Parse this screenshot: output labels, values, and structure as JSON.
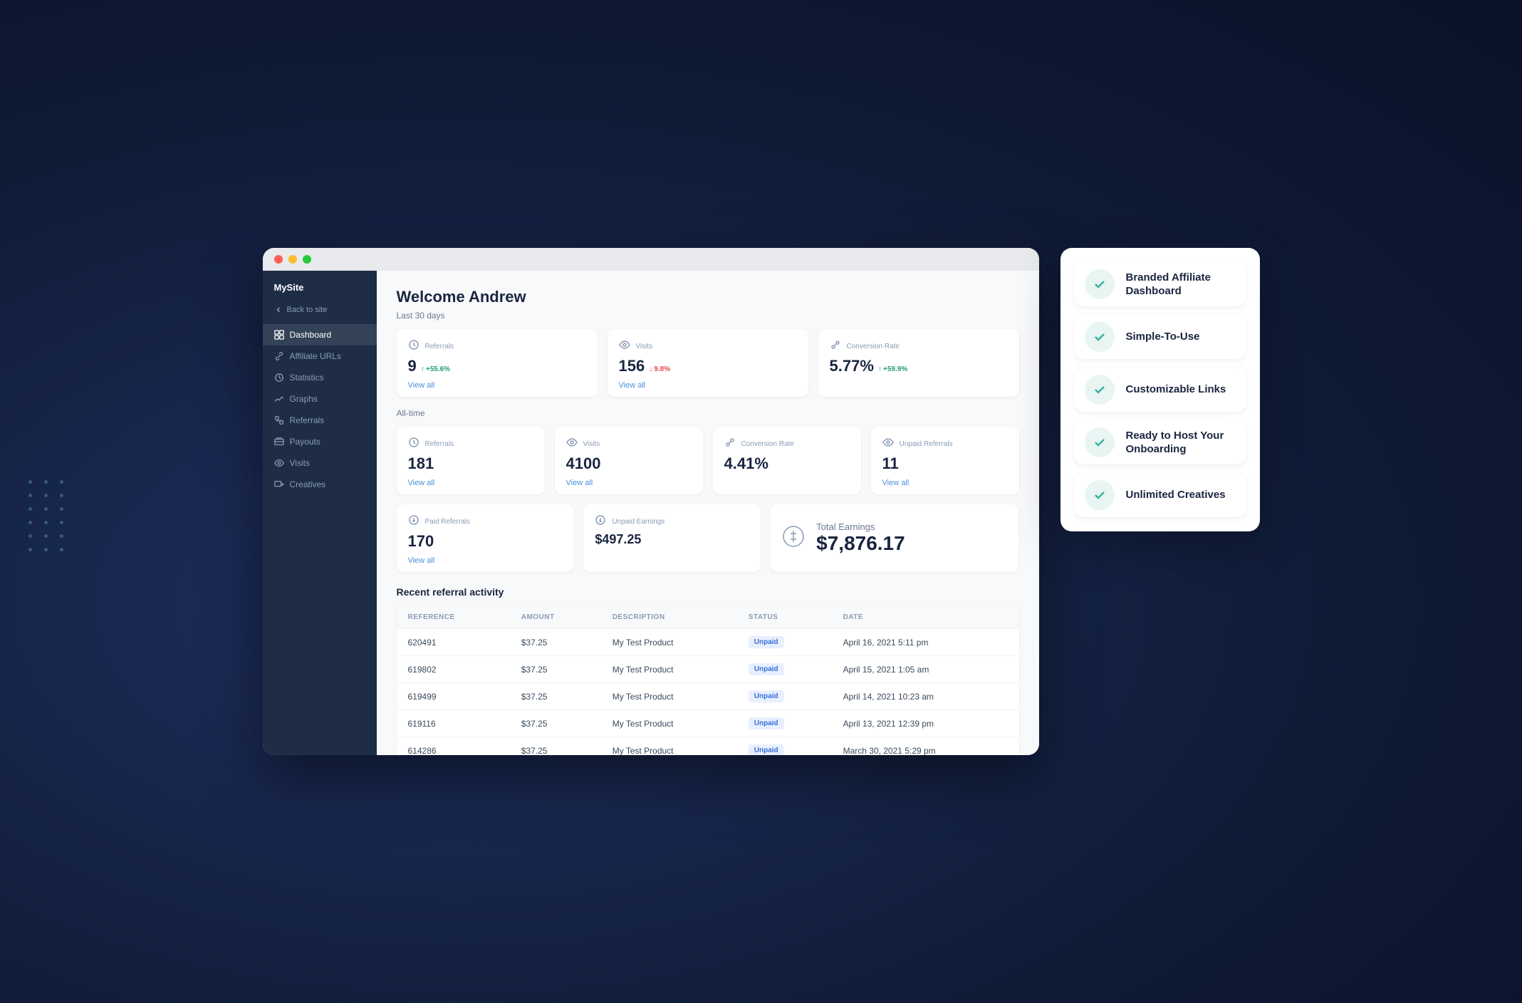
{
  "sidebar": {
    "brand": "MySite",
    "back_label": "Back to site",
    "nav_items": [
      {
        "id": "dashboard",
        "label": "Dashboard",
        "active": true
      },
      {
        "id": "affiliate-urls",
        "label": "Affiliate URLs",
        "active": false
      },
      {
        "id": "statistics",
        "label": "Statistics",
        "active": false
      },
      {
        "id": "graphs",
        "label": "Graphs",
        "active": false
      },
      {
        "id": "referrals",
        "label": "Referrals",
        "active": false
      },
      {
        "id": "payouts",
        "label": "Payouts",
        "active": false
      },
      {
        "id": "visits",
        "label": "Visits",
        "active": false
      },
      {
        "id": "creatives",
        "label": "Creatives",
        "active": false
      }
    ]
  },
  "main": {
    "welcome": "Welcome Andrew",
    "last30_label": "Last 30 days",
    "alltime_label": "All-time",
    "recent_activity_label": "Recent referral activity",
    "last30": {
      "referrals": {
        "label": "Referrals",
        "value": "9",
        "change": "+55.6%",
        "change_dir": "up",
        "view_all": "View all"
      },
      "visits": {
        "label": "Visits",
        "value": "156",
        "change": "9.8%",
        "change_dir": "down",
        "view_all": "View all"
      },
      "conversion": {
        "label": "Conversion Rate",
        "value": "5.77%",
        "change": "+59.9%",
        "change_dir": "up"
      }
    },
    "alltime": {
      "referrals": {
        "label": "Referrals",
        "value": "181",
        "view_all": "View all"
      },
      "visits": {
        "label": "Visits",
        "value": "4100",
        "view_all": "View all"
      },
      "conversion": {
        "label": "Conversion Rate",
        "value": "4.41%"
      },
      "unpaid_referrals": {
        "label": "Unpaid Referrals",
        "value": "11",
        "view_all": "View all"
      },
      "paid_referrals": {
        "label": "Paid Referrals",
        "value": "170",
        "view_all": "View all"
      },
      "unpaid_earnings": {
        "label": "Unpaid Earnings",
        "value": "$497.25"
      },
      "total_earnings": {
        "label": "Total Earnings",
        "value": "$7,876.17"
      }
    },
    "table": {
      "columns": [
        "Reference",
        "Amount",
        "Description",
        "Status",
        "Date"
      ],
      "rows": [
        {
          "ref": "620491",
          "amount": "$37.25",
          "desc": "My Test Product",
          "status": "Unpaid",
          "date": "April 16, 2021 5:11 pm"
        },
        {
          "ref": "619802",
          "amount": "$37.25",
          "desc": "My Test Product",
          "status": "Unpaid",
          "date": "April 15, 2021 1:05 am"
        },
        {
          "ref": "619499",
          "amount": "$37.25",
          "desc": "My Test Product",
          "status": "Unpaid",
          "date": "April 14, 2021 10:23 am"
        },
        {
          "ref": "619116",
          "amount": "$37.25",
          "desc": "My Test Product",
          "status": "Unpaid",
          "date": "April 13, 2021 12:39 pm"
        },
        {
          "ref": "614286",
          "amount": "$37.25",
          "desc": "My Test Product",
          "status": "Unpaid",
          "date": "March 30, 2021 5:29 pm"
        }
      ]
    }
  },
  "feature_panel": {
    "items": [
      {
        "id": "branded",
        "label": "Branded Affiliate Dashboard"
      },
      {
        "id": "simple",
        "label": "Simple-To-Use"
      },
      {
        "id": "customizable",
        "label": "Customizable Links"
      },
      {
        "id": "onboarding",
        "label": "Ready to Host Your Onboarding"
      },
      {
        "id": "unlimited",
        "label": "Unlimited Creatives"
      }
    ]
  }
}
